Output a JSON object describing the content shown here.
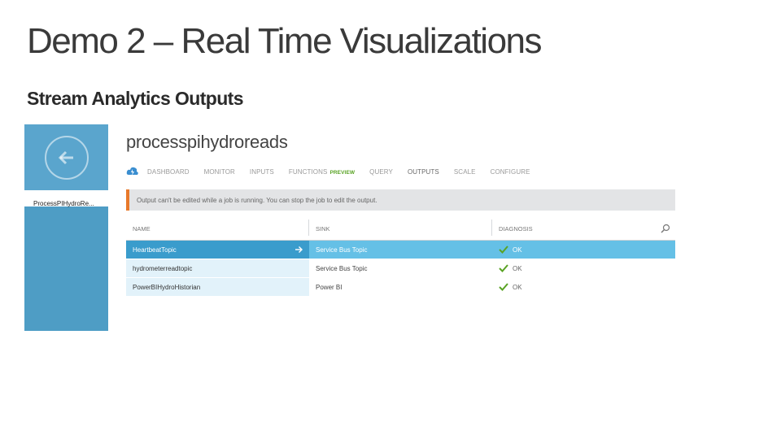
{
  "slide": {
    "title": "Demo 2 – Real Time Visualizations",
    "subtitle": "Stream Analytics Outputs"
  },
  "blade": {
    "back_icon": "back-arrow-icon",
    "label": "ProcessPIHydroRe..."
  },
  "job": {
    "name": "processpihydroreads"
  },
  "tabs": [
    {
      "label": "DASHBOARD"
    },
    {
      "label": "MONITOR"
    },
    {
      "label": "INPUTS"
    },
    {
      "label": "FUNCTIONS",
      "badge": "PREVIEW"
    },
    {
      "label": "QUERY"
    },
    {
      "label": "OUTPUTS"
    },
    {
      "label": "SCALE"
    },
    {
      "label": "CONFIGURE"
    }
  ],
  "banner": {
    "text": "Output can't be edited while a job is running. You can stop the job to edit the output.",
    "accent": "#e8792b"
  },
  "table": {
    "headers": [
      "NAME",
      "SINK",
      "DIAGNOSIS"
    ],
    "rows": [
      {
        "name": "HeartbeatTopic",
        "sink": "Service Bus Topic",
        "diagnosis": "OK"
      },
      {
        "name": "hydrometerreadtopic",
        "sink": "Service Bus Topic",
        "diagnosis": "OK"
      },
      {
        "name": "PowerBIHydroHistorian",
        "sink": "Power BI",
        "diagnosis": "OK"
      }
    ]
  },
  "colors": {
    "blade": "#4e9dc5",
    "selected_row": "#65c0e6",
    "ok_check": "#59a324"
  }
}
